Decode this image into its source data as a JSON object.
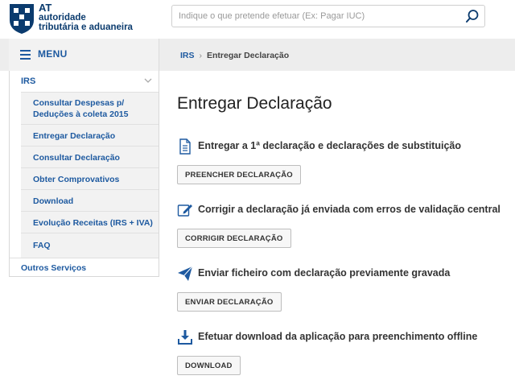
{
  "header": {
    "logo": {
      "at": "AT",
      "line1": "autoridade",
      "line2": "tributária e aduaneira"
    },
    "search": {
      "placeholder": "Indique o que pretende efetuar (Ex: Pagar IUC)",
      "value": ""
    }
  },
  "sidebar": {
    "menu_label": "MENU",
    "section": "IRS",
    "items": [
      {
        "label": "Consultar Despesas p/ Deduções à coleta 2015"
      },
      {
        "label": "Entregar Declaração"
      },
      {
        "label": "Consultar Declaração"
      },
      {
        "label": "Obter Comprovativos"
      },
      {
        "label": "Download"
      },
      {
        "label": "Evolução Receitas (IRS + IVA)"
      },
      {
        "label": "FAQ"
      }
    ],
    "other": "Outros Serviços"
  },
  "breadcrumb": {
    "home": "IRS",
    "separator": "›",
    "current": "Entregar Declaração"
  },
  "main": {
    "title": "Entregar Declaração",
    "sections": [
      {
        "icon": "document-icon",
        "heading": "Entregar a 1ª declaração e declarações de substituição",
        "button": "PREENCHER DECLARAÇÃO"
      },
      {
        "icon": "edit-icon",
        "heading": "Corrigir a declaração já enviada com erros de validação central",
        "button": "CORRIGIR DECLARAÇÃO"
      },
      {
        "icon": "paper-plane-icon",
        "heading": "Enviar ficheiro com declaração previamente gravada",
        "button": "ENVIAR DECLARAÇÃO"
      },
      {
        "icon": "download-icon",
        "heading": "Efetuar download da aplicação para preenchimento offline",
        "button": "DOWNLOAD"
      }
    ]
  },
  "colors": {
    "brand": "#0b3b6e",
    "link": "#1e5aa0",
    "band": "#ededed"
  }
}
